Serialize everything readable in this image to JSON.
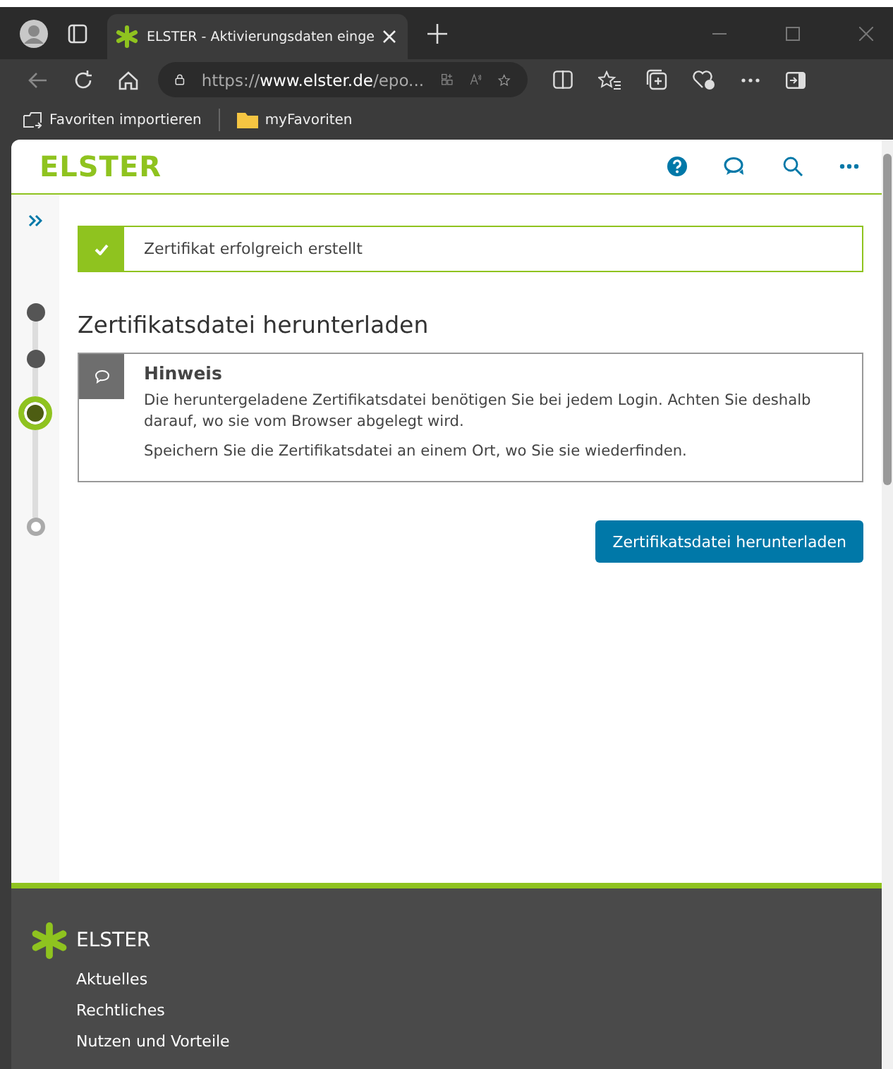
{
  "browser": {
    "tab_title": "ELSTER - Aktivierungsdaten einge",
    "url_scheme": "https://",
    "url_host": "www.elster.de",
    "url_path": "/epo...",
    "favorites": [
      "Favoriten importieren",
      "myFavoriten"
    ]
  },
  "header": {
    "logo": "ELSTER"
  },
  "steps": [
    {
      "completed": true,
      "selected": false
    },
    {
      "completed": true,
      "selected": false
    },
    {
      "completed": false,
      "selected": true
    },
    {
      "completed": false,
      "selected": false
    }
  ],
  "notification": {
    "kind": "success",
    "text": "Zertifikat erfolgreich erstellt"
  },
  "heading": "Zertifikatsdatei herunterladen",
  "note": {
    "title": "Hinweis",
    "paragraphs": [
      "Die heruntergeladene Zertifikatsdatei benötigen Sie bei jedem Login. Achten Sie deshalb darauf, wo sie vom Browser abgelegt wird.",
      "Speichern Sie die Zertifikatsdatei an einem Ort, wo Sie sie wiederfinden."
    ]
  },
  "button": "Zertifikatsdatei herunterladen",
  "footer": {
    "logo": "ELSTER",
    "links": [
      "Aktuelles",
      "Rechtliches",
      "Nutzen und Vorteile"
    ]
  }
}
